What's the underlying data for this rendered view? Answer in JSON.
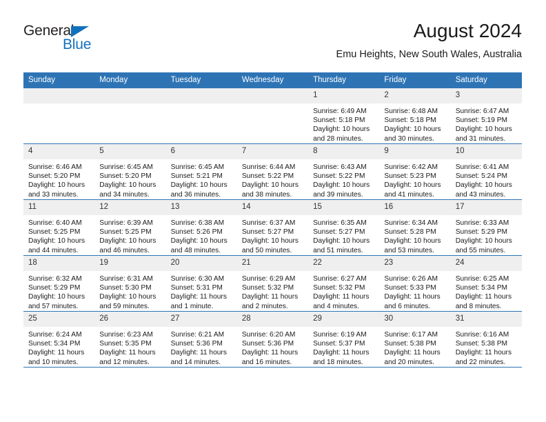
{
  "brand": {
    "name_part1": "General",
    "name_part2": "Blue",
    "accent_color": "#1271bd"
  },
  "header": {
    "title": "August 2024",
    "subtitle": "Emu Heights, New South Wales, Australia"
  },
  "colors": {
    "header_blue": "#2e74b5",
    "daynum_band": "#efefef",
    "text": "#1a1a1a"
  },
  "weekday_headers": [
    "Sunday",
    "Monday",
    "Tuesday",
    "Wednesday",
    "Thursday",
    "Friday",
    "Saturday"
  ],
  "weeks": [
    [
      {
        "day": "",
        "sunrise": "",
        "sunset": "",
        "daylight1": "",
        "daylight2": ""
      },
      {
        "day": "",
        "sunrise": "",
        "sunset": "",
        "daylight1": "",
        "daylight2": ""
      },
      {
        "day": "",
        "sunrise": "",
        "sunset": "",
        "daylight1": "",
        "daylight2": ""
      },
      {
        "day": "",
        "sunrise": "",
        "sunset": "",
        "daylight1": "",
        "daylight2": ""
      },
      {
        "day": "1",
        "sunrise": "Sunrise: 6:49 AM",
        "sunset": "Sunset: 5:18 PM",
        "daylight1": "Daylight: 10 hours",
        "daylight2": "and 28 minutes."
      },
      {
        "day": "2",
        "sunrise": "Sunrise: 6:48 AM",
        "sunset": "Sunset: 5:18 PM",
        "daylight1": "Daylight: 10 hours",
        "daylight2": "and 30 minutes."
      },
      {
        "day": "3",
        "sunrise": "Sunrise: 6:47 AM",
        "sunset": "Sunset: 5:19 PM",
        "daylight1": "Daylight: 10 hours",
        "daylight2": "and 31 minutes."
      }
    ],
    [
      {
        "day": "4",
        "sunrise": "Sunrise: 6:46 AM",
        "sunset": "Sunset: 5:20 PM",
        "daylight1": "Daylight: 10 hours",
        "daylight2": "and 33 minutes."
      },
      {
        "day": "5",
        "sunrise": "Sunrise: 6:45 AM",
        "sunset": "Sunset: 5:20 PM",
        "daylight1": "Daylight: 10 hours",
        "daylight2": "and 34 minutes."
      },
      {
        "day": "6",
        "sunrise": "Sunrise: 6:45 AM",
        "sunset": "Sunset: 5:21 PM",
        "daylight1": "Daylight: 10 hours",
        "daylight2": "and 36 minutes."
      },
      {
        "day": "7",
        "sunrise": "Sunrise: 6:44 AM",
        "sunset": "Sunset: 5:22 PM",
        "daylight1": "Daylight: 10 hours",
        "daylight2": "and 38 minutes."
      },
      {
        "day": "8",
        "sunrise": "Sunrise: 6:43 AM",
        "sunset": "Sunset: 5:22 PM",
        "daylight1": "Daylight: 10 hours",
        "daylight2": "and 39 minutes."
      },
      {
        "day": "9",
        "sunrise": "Sunrise: 6:42 AM",
        "sunset": "Sunset: 5:23 PM",
        "daylight1": "Daylight: 10 hours",
        "daylight2": "and 41 minutes."
      },
      {
        "day": "10",
        "sunrise": "Sunrise: 6:41 AM",
        "sunset": "Sunset: 5:24 PM",
        "daylight1": "Daylight: 10 hours",
        "daylight2": "and 43 minutes."
      }
    ],
    [
      {
        "day": "11",
        "sunrise": "Sunrise: 6:40 AM",
        "sunset": "Sunset: 5:25 PM",
        "daylight1": "Daylight: 10 hours",
        "daylight2": "and 44 minutes."
      },
      {
        "day": "12",
        "sunrise": "Sunrise: 6:39 AM",
        "sunset": "Sunset: 5:25 PM",
        "daylight1": "Daylight: 10 hours",
        "daylight2": "and 46 minutes."
      },
      {
        "day": "13",
        "sunrise": "Sunrise: 6:38 AM",
        "sunset": "Sunset: 5:26 PM",
        "daylight1": "Daylight: 10 hours",
        "daylight2": "and 48 minutes."
      },
      {
        "day": "14",
        "sunrise": "Sunrise: 6:37 AM",
        "sunset": "Sunset: 5:27 PM",
        "daylight1": "Daylight: 10 hours",
        "daylight2": "and 50 minutes."
      },
      {
        "day": "15",
        "sunrise": "Sunrise: 6:35 AM",
        "sunset": "Sunset: 5:27 PM",
        "daylight1": "Daylight: 10 hours",
        "daylight2": "and 51 minutes."
      },
      {
        "day": "16",
        "sunrise": "Sunrise: 6:34 AM",
        "sunset": "Sunset: 5:28 PM",
        "daylight1": "Daylight: 10 hours",
        "daylight2": "and 53 minutes."
      },
      {
        "day": "17",
        "sunrise": "Sunrise: 6:33 AM",
        "sunset": "Sunset: 5:29 PM",
        "daylight1": "Daylight: 10 hours",
        "daylight2": "and 55 minutes."
      }
    ],
    [
      {
        "day": "18",
        "sunrise": "Sunrise: 6:32 AM",
        "sunset": "Sunset: 5:29 PM",
        "daylight1": "Daylight: 10 hours",
        "daylight2": "and 57 minutes."
      },
      {
        "day": "19",
        "sunrise": "Sunrise: 6:31 AM",
        "sunset": "Sunset: 5:30 PM",
        "daylight1": "Daylight: 10 hours",
        "daylight2": "and 59 minutes."
      },
      {
        "day": "20",
        "sunrise": "Sunrise: 6:30 AM",
        "sunset": "Sunset: 5:31 PM",
        "daylight1": "Daylight: 11 hours",
        "daylight2": "and 1 minute."
      },
      {
        "day": "21",
        "sunrise": "Sunrise: 6:29 AM",
        "sunset": "Sunset: 5:32 PM",
        "daylight1": "Daylight: 11 hours",
        "daylight2": "and 2 minutes."
      },
      {
        "day": "22",
        "sunrise": "Sunrise: 6:27 AM",
        "sunset": "Sunset: 5:32 PM",
        "daylight1": "Daylight: 11 hours",
        "daylight2": "and 4 minutes."
      },
      {
        "day": "23",
        "sunrise": "Sunrise: 6:26 AM",
        "sunset": "Sunset: 5:33 PM",
        "daylight1": "Daylight: 11 hours",
        "daylight2": "and 6 minutes."
      },
      {
        "day": "24",
        "sunrise": "Sunrise: 6:25 AM",
        "sunset": "Sunset: 5:34 PM",
        "daylight1": "Daylight: 11 hours",
        "daylight2": "and 8 minutes."
      }
    ],
    [
      {
        "day": "25",
        "sunrise": "Sunrise: 6:24 AM",
        "sunset": "Sunset: 5:34 PM",
        "daylight1": "Daylight: 11 hours",
        "daylight2": "and 10 minutes."
      },
      {
        "day": "26",
        "sunrise": "Sunrise: 6:23 AM",
        "sunset": "Sunset: 5:35 PM",
        "daylight1": "Daylight: 11 hours",
        "daylight2": "and 12 minutes."
      },
      {
        "day": "27",
        "sunrise": "Sunrise: 6:21 AM",
        "sunset": "Sunset: 5:36 PM",
        "daylight1": "Daylight: 11 hours",
        "daylight2": "and 14 minutes."
      },
      {
        "day": "28",
        "sunrise": "Sunrise: 6:20 AM",
        "sunset": "Sunset: 5:36 PM",
        "daylight1": "Daylight: 11 hours",
        "daylight2": "and 16 minutes."
      },
      {
        "day": "29",
        "sunrise": "Sunrise: 6:19 AM",
        "sunset": "Sunset: 5:37 PM",
        "daylight1": "Daylight: 11 hours",
        "daylight2": "and 18 minutes."
      },
      {
        "day": "30",
        "sunrise": "Sunrise: 6:17 AM",
        "sunset": "Sunset: 5:38 PM",
        "daylight1": "Daylight: 11 hours",
        "daylight2": "and 20 minutes."
      },
      {
        "day": "31",
        "sunrise": "Sunrise: 6:16 AM",
        "sunset": "Sunset: 5:38 PM",
        "daylight1": "Daylight: 11 hours",
        "daylight2": "and 22 minutes."
      }
    ]
  ]
}
